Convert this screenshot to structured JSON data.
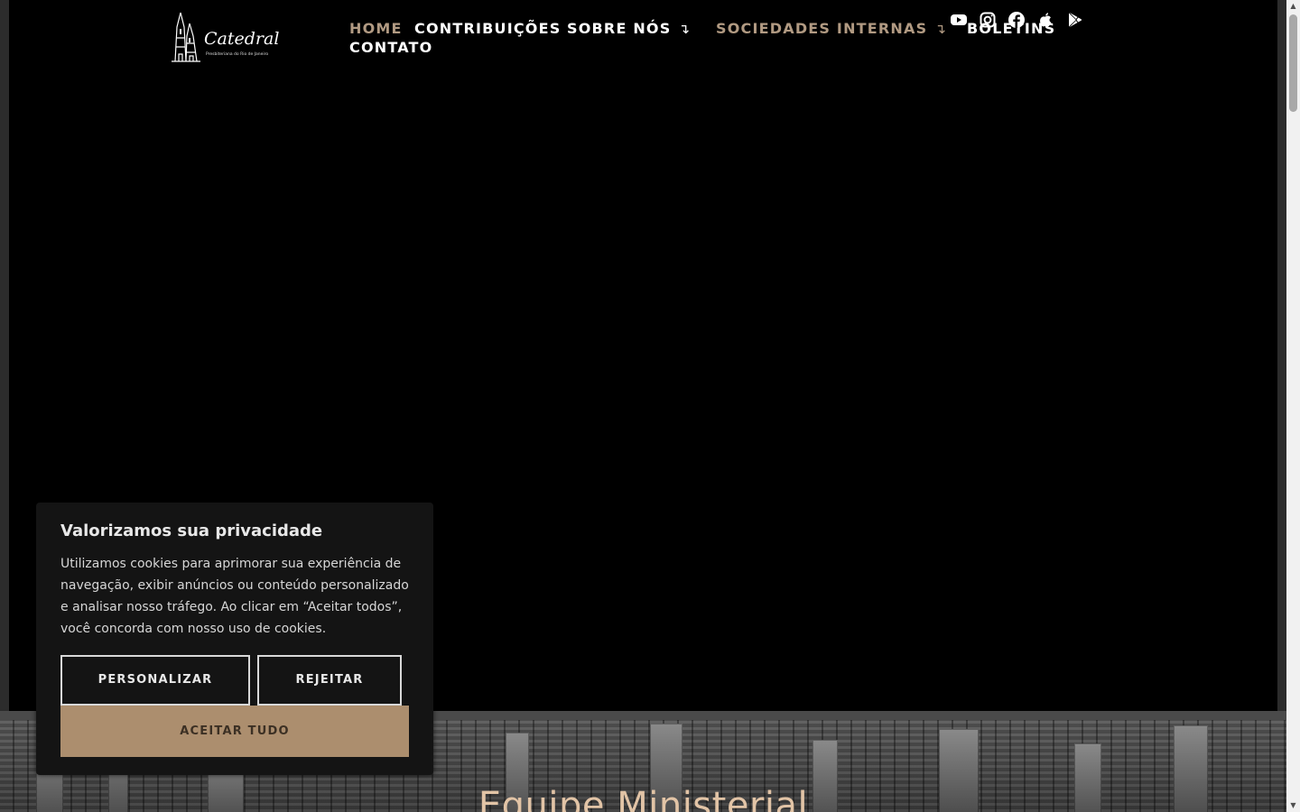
{
  "logo": {
    "name": "Catedral",
    "tagline": "Presbiteriana do Rio de Janeiro"
  },
  "nav": {
    "items": [
      {
        "label": "HOME",
        "state": "active"
      },
      {
        "label": "CONTRIBUIÇÕES"
      },
      {
        "label": "SOBRE NÓS",
        "dropdown_marker": "↴"
      },
      {
        "label": "SOCIEDADES INTERNAS",
        "dropdown_marker": "↴"
      },
      {
        "label": "BOLETINS"
      },
      {
        "label": "CONTATO"
      }
    ]
  },
  "social": [
    "youtube-icon",
    "instagram-icon",
    "facebook-icon",
    "apple-icon",
    "google-play-icon"
  ],
  "section": {
    "title": "Equipe Ministerial"
  },
  "cookie": {
    "title": "Valorizamos sua privacidade",
    "text": "Utilizamos cookies para aprimorar sua experiência de navegação, exibir anúncios ou conteúdo personalizado e analisar nosso tráfego. Ao clicar em “Aceitar todos”, você concorda com nosso uso de cookies.",
    "customize_label": "PERSONALIZAR",
    "reject_label": "REJEITAR",
    "accept_label": "ACEITAR TUDO"
  },
  "colors": {
    "accent": "#ac8e6e",
    "nav_active": "#b19a82",
    "section_title": "#e2c4a6",
    "dialog_bg": "#141414"
  }
}
